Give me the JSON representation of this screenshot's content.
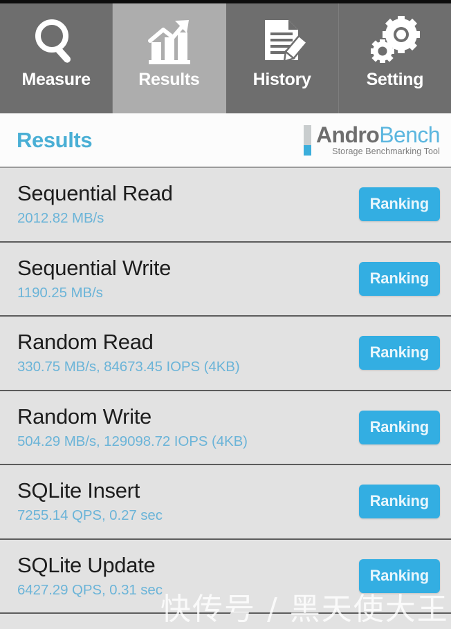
{
  "tabs": [
    {
      "label": "Measure",
      "icon": "magnifier-icon",
      "active": false
    },
    {
      "label": "Results",
      "icon": "bar-chart-arrow-icon",
      "active": true
    },
    {
      "label": "History",
      "icon": "document-pencil-icon",
      "active": false
    },
    {
      "label": "Setting",
      "icon": "gears-icon",
      "active": false
    }
  ],
  "header": {
    "title": "Results",
    "logo_primary": "Andro",
    "logo_secondary": "Bench",
    "logo_tagline": "Storage Benchmarking Tool"
  },
  "results": {
    "ranking_label": "Ranking",
    "rows": [
      {
        "title": "Sequential Read",
        "value": "2012.82 MB/s"
      },
      {
        "title": "Sequential Write",
        "value": "1190.25 MB/s"
      },
      {
        "title": "Random Read",
        "value": "330.75 MB/s, 84673.45 IOPS (4KB)"
      },
      {
        "title": "Random Write",
        "value": "504.29 MB/s, 129098.72 IOPS (4KB)"
      },
      {
        "title": "SQLite Insert",
        "value": "7255.14 QPS, 0.27 sec"
      },
      {
        "title": "SQLite Update",
        "value": "6427.29 QPS, 0.31 sec"
      }
    ]
  },
  "watermark": {
    "text": "快传号 / 黑天使大王"
  },
  "colors": {
    "tab_inactive_bg": "#6E6E6E",
    "tab_active_bg": "#ADADAD",
    "accent_blue": "#33AEE2",
    "title_blue": "#4AAFD5",
    "value_blue": "#6BB4D8",
    "row_bg": "#E2E2E2",
    "row_divider": "#5C5C5C",
    "header_bg": "#FCFCFC"
  }
}
